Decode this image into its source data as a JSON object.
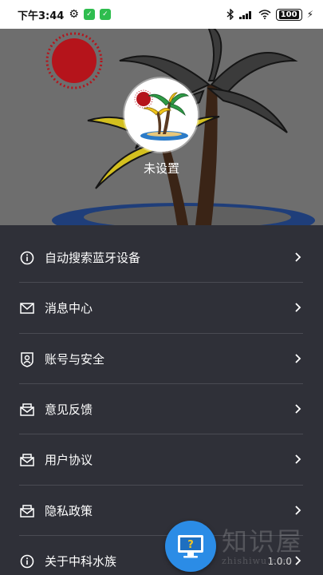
{
  "status_bar": {
    "time": "下午3:44",
    "badge_a": "✓",
    "badge_b": "✓",
    "battery": "100"
  },
  "profile": {
    "username": "未设置"
  },
  "menu": {
    "items": [
      {
        "label": "自动搜索蓝牙设备",
        "icon": "info-circle-icon"
      },
      {
        "label": "消息中心",
        "icon": "mail-icon"
      },
      {
        "label": "账号与安全",
        "icon": "shield-user-icon"
      },
      {
        "label": "意见反馈",
        "icon": "inbox-mail-icon"
      },
      {
        "label": "用户协议",
        "icon": "inbox-mail-icon"
      },
      {
        "label": "隐私政策",
        "icon": "inbox-mail-icon"
      },
      {
        "label": "关于中科水族",
        "icon": "info-circle-icon",
        "value": "1.0.0"
      }
    ]
  },
  "help_button": {
    "glyph": "?"
  },
  "watermark": {
    "big": "知识屋",
    "small": "zhishiwu.com"
  },
  "colors": {
    "status_bar_bg": "#ffffff",
    "menu_bg": "#2f3038",
    "divider": "#4a4b53",
    "fab": "#2b8ce6",
    "sun": "#b5141b",
    "palm_leaf": "#2e9b46",
    "palm_yellow": "#f1c419"
  }
}
